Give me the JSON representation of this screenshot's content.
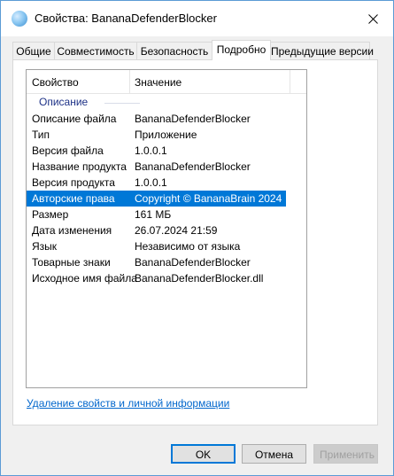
{
  "window": {
    "title": "Свойства: BananaDefenderBlocker",
    "accent_color": "#0078d7"
  },
  "tabs": [
    {
      "label": "Общие"
    },
    {
      "label": "Совместимость"
    },
    {
      "label": "Безопасность"
    },
    {
      "label": "Подробно",
      "active": true
    },
    {
      "label": "Предыдущие версии"
    }
  ],
  "list": {
    "headers": {
      "property": "Свойство",
      "value": "Значение"
    },
    "group": "Описание",
    "rows": [
      {
        "property": "Описание файла",
        "value": "BananaDefenderBlocker"
      },
      {
        "property": "Тип",
        "value": "Приложение"
      },
      {
        "property": "Версия файла",
        "value": "1.0.0.1"
      },
      {
        "property": "Название продукта",
        "value": "BananaDefenderBlocker"
      },
      {
        "property": "Версия продукта",
        "value": "1.0.0.1"
      },
      {
        "property": "Авторские права",
        "value": "Copyright © BananaBrain 2024",
        "selected": true
      },
      {
        "property": "Размер",
        "value": "161 МБ"
      },
      {
        "property": "Дата изменения",
        "value": "26.07.2024 21:59"
      },
      {
        "property": "Язык",
        "value": "Независимо от языка"
      },
      {
        "property": "Товарные знаки",
        "value": "BananaDefenderBlocker"
      },
      {
        "property": "Исходное имя файла",
        "value": "BananaDefenderBlocker.dll"
      }
    ]
  },
  "remove_link": "Удаление свойств и личной информации",
  "buttons": {
    "ok": "OK",
    "cancel": "Отмена",
    "apply": "Применить"
  },
  "icons": {
    "window": "app-sphere-icon",
    "close": "close-icon"
  }
}
